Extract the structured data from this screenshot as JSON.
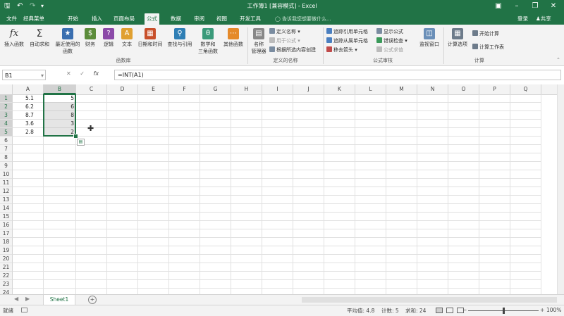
{
  "window": {
    "title": "工作簿1 [兼容模式] - Excel",
    "quick_access": [
      "save-icon",
      "undo-icon",
      "redo-icon",
      "customize-icon"
    ],
    "controls": [
      "ribbon-display-icon",
      "minimize-icon",
      "restore-icon",
      "close-icon"
    ]
  },
  "tabs": [
    {
      "label": "文件"
    },
    {
      "label": "经典菜单"
    },
    {
      "label": "开始"
    },
    {
      "label": "插入"
    },
    {
      "label": "页面布局"
    },
    {
      "label": "公式",
      "active": true
    },
    {
      "label": "数据"
    },
    {
      "label": "审阅"
    },
    {
      "label": "视图"
    },
    {
      "label": "开发工具"
    }
  ],
  "tellme": "告诉我您想要做什么...",
  "account": {
    "login": "登录",
    "share": "共享"
  },
  "ribbon": {
    "library": {
      "insert_function": "插入函数",
      "autosum": "自动求和",
      "recent_line1": "最近使用的",
      "recent_line2": "函数",
      "financial": "财务",
      "logical": "逻辑",
      "text": "文本",
      "datetime": "日期和时间",
      "lookup": "查找与引用",
      "math_line1": "数学和",
      "math_line2": "三角函数",
      "more": "其他函数",
      "group_label": "函数库"
    },
    "names": {
      "manager_line1": "名称",
      "manager_line2": "管理器",
      "define": "定义名称",
      "use_in_formula": "用于公式",
      "create_from_selection": "根据所选内容创建",
      "group_label": "定义的名称"
    },
    "audit": {
      "trace_precedents": "追踪引用单元格",
      "trace_dependents": "追踪从属单元格",
      "remove_arrows": "移去箭头",
      "show_formulas": "显示公式",
      "error_checking": "错误检查",
      "evaluate_formula": "公式求值",
      "watch_window": "监视窗口",
      "group_label": "公式审核"
    },
    "calc": {
      "options": "计算选项",
      "calc_now": "开始计算",
      "calc_sheet": "计算工作表",
      "group_label": "计算"
    }
  },
  "formula_bar": {
    "name_box": "B1",
    "cancel": "✕",
    "enter": "✓",
    "fx": "fx",
    "formula": "=INT(A1)"
  },
  "columns": [
    "A",
    "B",
    "C",
    "D",
    "E",
    "F",
    "G",
    "H",
    "I",
    "J",
    "K",
    "L",
    "M",
    "N",
    "O",
    "P",
    "Q"
  ],
  "rows": [
    "1",
    "2",
    "3",
    "4",
    "5",
    "6",
    "7",
    "8",
    "9",
    "10",
    "11",
    "12",
    "13",
    "14",
    "15",
    "16",
    "17",
    "18",
    "19",
    "20",
    "21",
    "22",
    "23",
    "24"
  ],
  "cells": {
    "A": [
      "5.1",
      "6.2",
      "8.7",
      "3.6",
      "2.8"
    ],
    "B": [
      "5",
      "6",
      "8",
      "3",
      "2"
    ]
  },
  "sheets": [
    {
      "label": "Sheet1",
      "active": true
    }
  ],
  "status": {
    "mode": "就绪",
    "average": "平均值: 4.8",
    "count": "计数: 5",
    "sum": "求和: 24",
    "zoom": "100%",
    "zoom_minus": "−",
    "zoom_plus": "+"
  },
  "colors": {
    "accent": "#217346",
    "selection": "#217346"
  }
}
